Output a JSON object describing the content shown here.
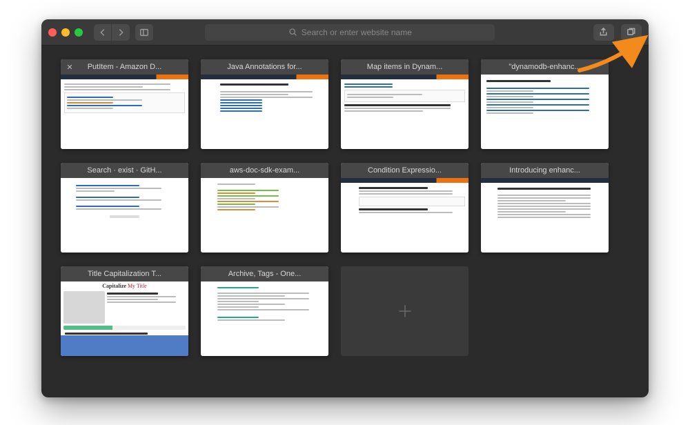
{
  "toolbar": {
    "url_placeholder": "Search or enter website name"
  },
  "tabs": [
    {
      "title": "PutItem - Amazon D...",
      "closable": true
    },
    {
      "title": "Java Annotations for...",
      "closable": false
    },
    {
      "title": "Map items in Dynam...",
      "closable": false
    },
    {
      "title": "\"dynamodb-enhanc...",
      "closable": false
    },
    {
      "title": "Search · exist · GitH...",
      "closable": false
    },
    {
      "title": "aws-doc-sdk-exam...",
      "closable": false
    },
    {
      "title": "Condition Expressio...",
      "closable": false
    },
    {
      "title": "Introducing enhanc...",
      "closable": false
    },
    {
      "title": "Title Capitalization T...",
      "closable": false
    },
    {
      "title": "Archive, Tags - One...",
      "closable": false
    }
  ],
  "icons": {
    "close_glyph": "✕"
  }
}
